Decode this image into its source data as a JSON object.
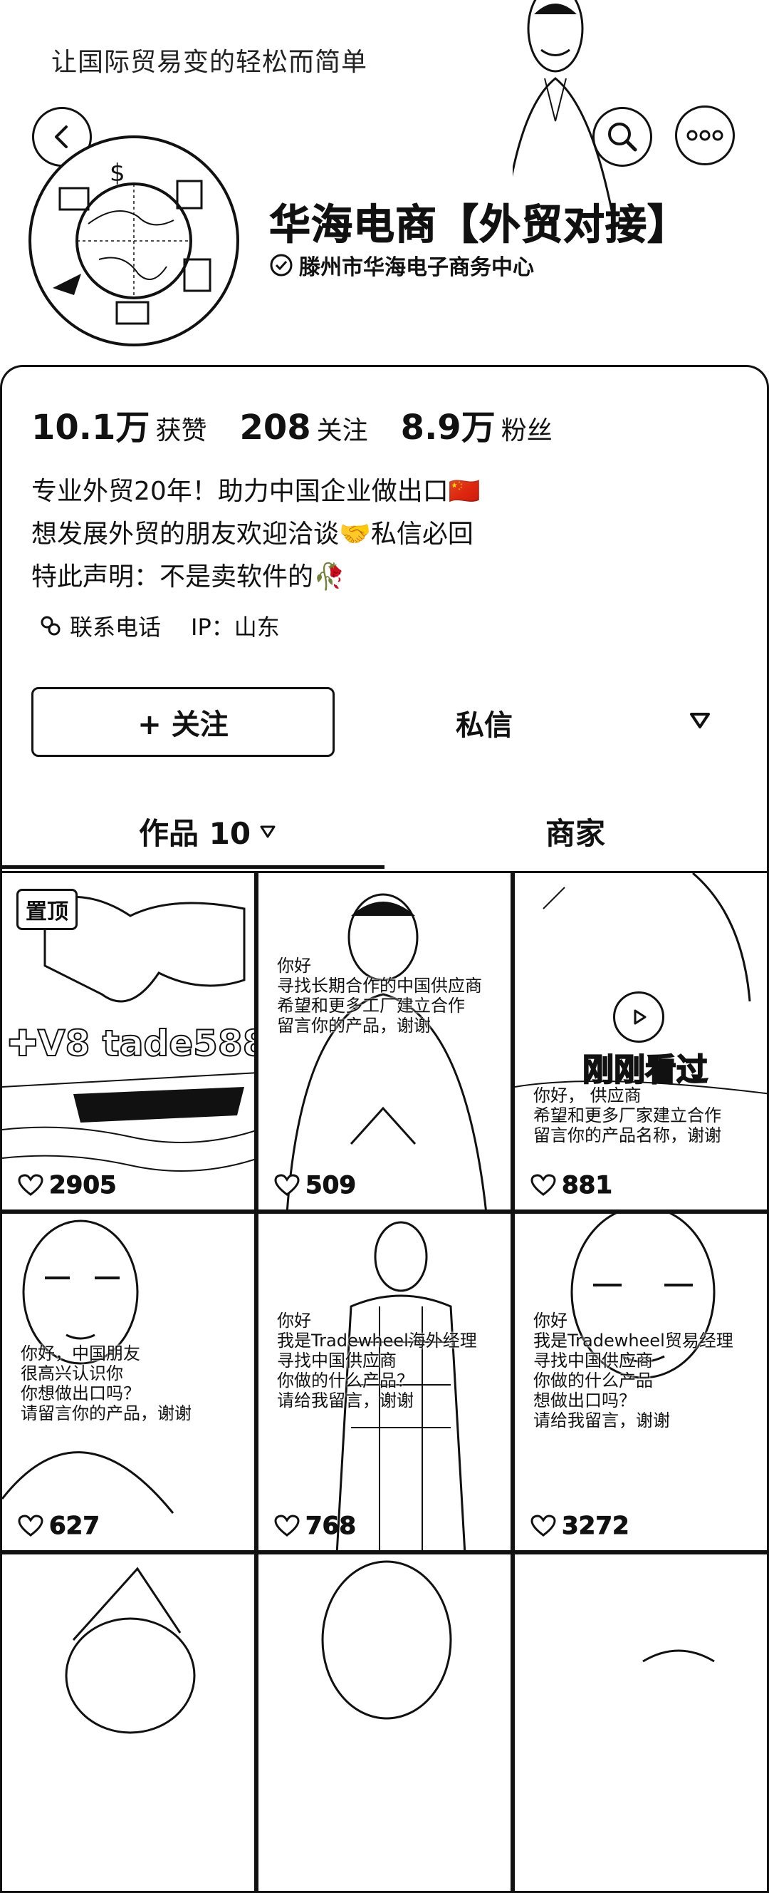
{
  "header": {
    "slogan": "让国际贸易变的轻松而简单",
    "name": "华海电商【外贸对接】",
    "verified_org": "滕州市华海电子商务中心"
  },
  "stats": [
    {
      "value": "10.1万",
      "label": "获赞"
    },
    {
      "value": "208",
      "label": "关注"
    },
    {
      "value": "8.9万",
      "label": "粉丝"
    }
  ],
  "bio": [
    "专业外贸20年！助力中国企业做出口🇨🇳",
    "想发展外贸的朋友欢迎洽谈🤝私信必回",
    "特此声明：不是卖软件的🥀"
  ],
  "meta": {
    "phone_label": "联系电话",
    "ip_label": "IP：山东"
  },
  "actions": {
    "follow": "+ 关注",
    "message": "私信"
  },
  "tabs": {
    "works": "作品 10",
    "shop": "商家"
  },
  "videos": [
    {
      "likes": "2905",
      "pinned": "置顶",
      "overlay": "✚V8 tade588",
      "captions": []
    },
    {
      "likes": "509",
      "captions": [
        "你好",
        "寻找长期合作的中国供应商",
        "希望和更多工厂建立合作",
        "留言你的产品，谢谢"
      ]
    },
    {
      "likes": "881",
      "seen": "刚刚看过",
      "captions": [
        "你好， 供应商",
        "希望和更多厂家建立合作",
        "留言你的产品名称，谢谢"
      ]
    },
    {
      "likes": "627",
      "captions": [
        "你好，中国朋友",
        "很高兴认识你",
        "你想做出口吗？",
        "请留言你的产品，谢谢"
      ]
    },
    {
      "likes": "768",
      "captions": [
        "你好",
        "我是Tradewheel海外经理",
        "寻找中国供应商",
        "你做的什么产品？",
        "请给我留言，谢谢"
      ]
    },
    {
      "likes": "3272",
      "captions": [
        "你好",
        "我是Tradewheel贸易经理",
        "寻找中国供应商",
        "你做的什么产品",
        "想做出口吗？",
        "请给我留言，谢谢"
      ]
    },
    {
      "likes": "",
      "captions": []
    },
    {
      "likes": "",
      "captions": []
    },
    {
      "likes": "",
      "captions": []
    }
  ]
}
